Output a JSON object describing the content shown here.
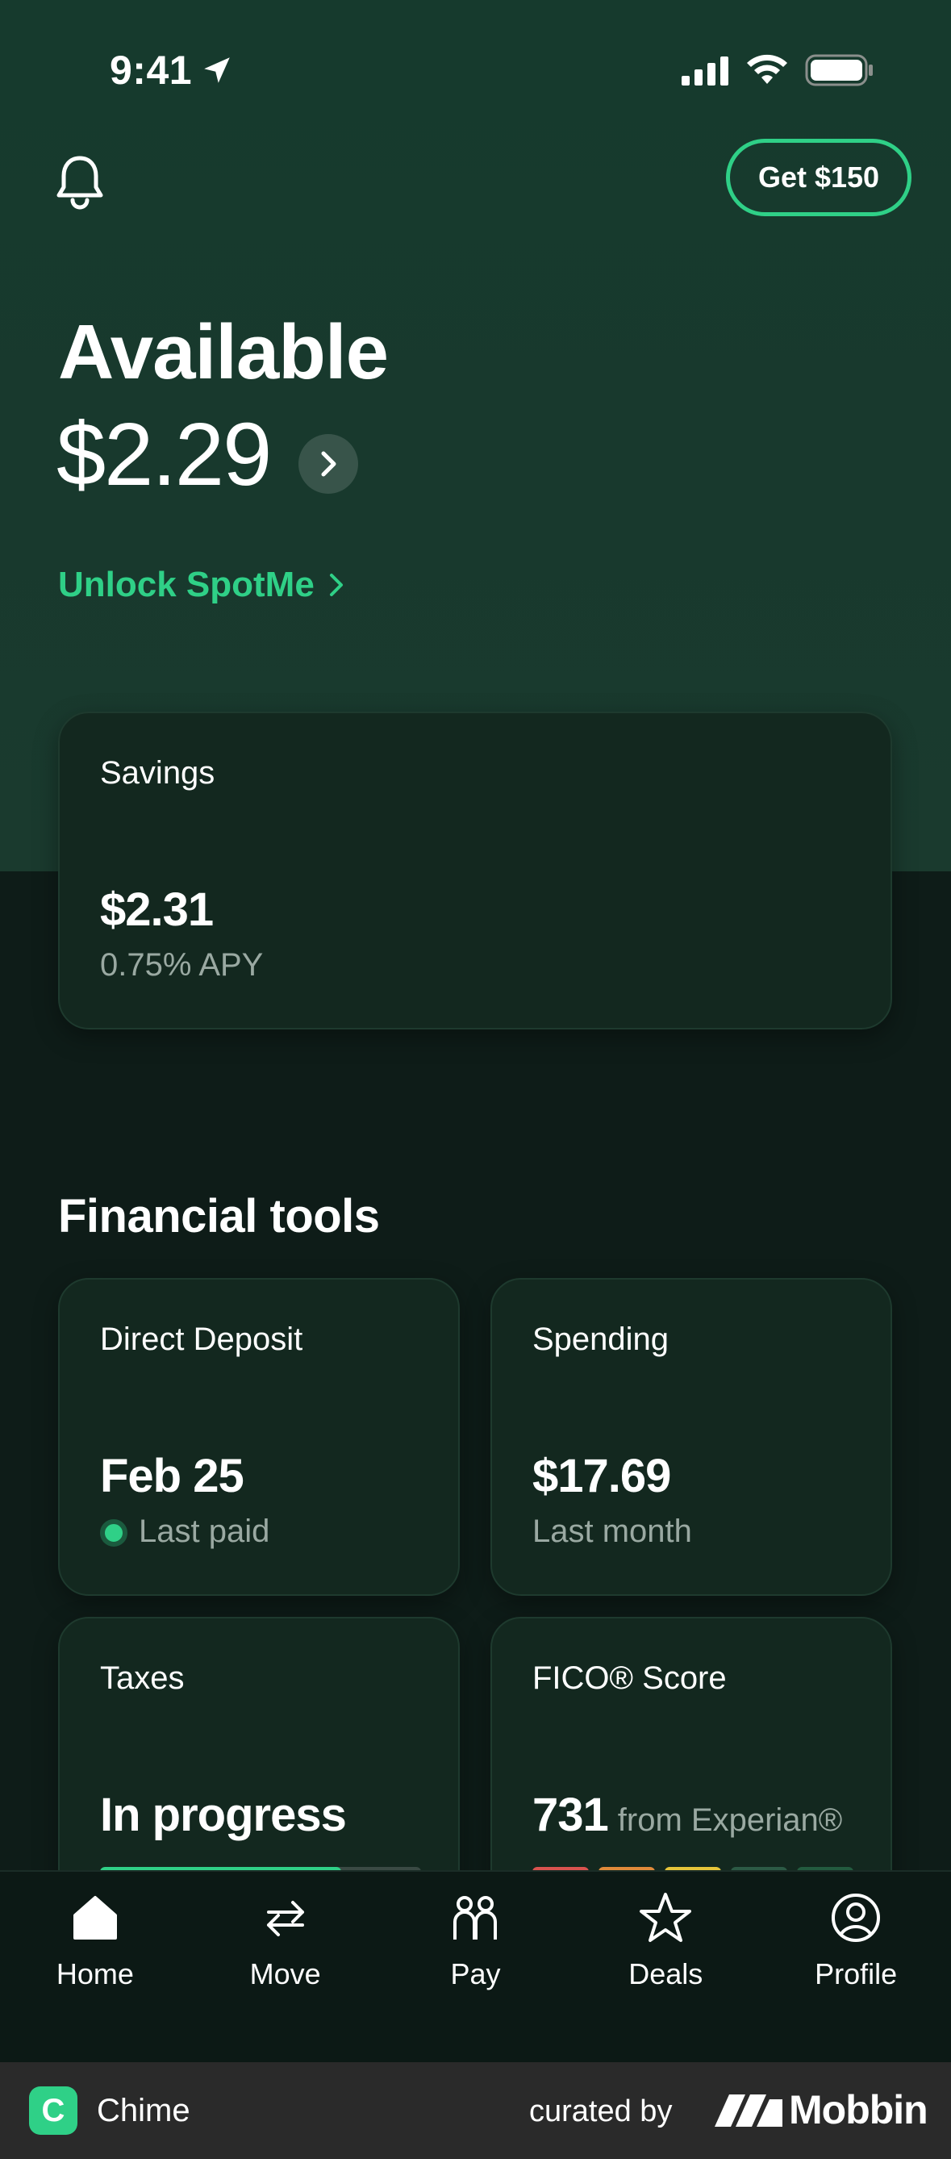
{
  "status_bar": {
    "time": "9:41"
  },
  "header": {
    "cta_label": "Get $150"
  },
  "balance": {
    "title": "Available",
    "amount": "$2.29",
    "spotme_label": "Unlock SpotMe"
  },
  "savings": {
    "label": "Savings",
    "amount": "$2.31",
    "apy": "0.75% APY"
  },
  "financial_tools": {
    "title": "Financial tools",
    "direct_deposit": {
      "label": "Direct Deposit",
      "value": "Feb 25",
      "sub": "Last paid"
    },
    "spending": {
      "label": "Spending",
      "value": "$17.69",
      "sub": "Last month"
    },
    "taxes": {
      "label": "Taxes",
      "value": "In progress",
      "progress": 0.75
    },
    "fico": {
      "label": "FICO® Score",
      "value": "731",
      "sub": "from Experian®"
    }
  },
  "tabbar": {
    "items": [
      {
        "label": "Home",
        "icon": "home-icon"
      },
      {
        "label": "Move",
        "icon": "transfer-icon"
      },
      {
        "label": "Pay",
        "icon": "people-icon"
      },
      {
        "label": "Deals",
        "icon": "star-icon"
      },
      {
        "label": "Profile",
        "icon": "profile-icon"
      }
    ]
  },
  "footer": {
    "app_name": "Chime",
    "curated_by": "curated by",
    "brand": "Mobbin"
  },
  "colors": {
    "accent": "#2fd087",
    "background_top": "#18392d",
    "background_bottom": "#0e1c18",
    "card": "#13281f"
  }
}
